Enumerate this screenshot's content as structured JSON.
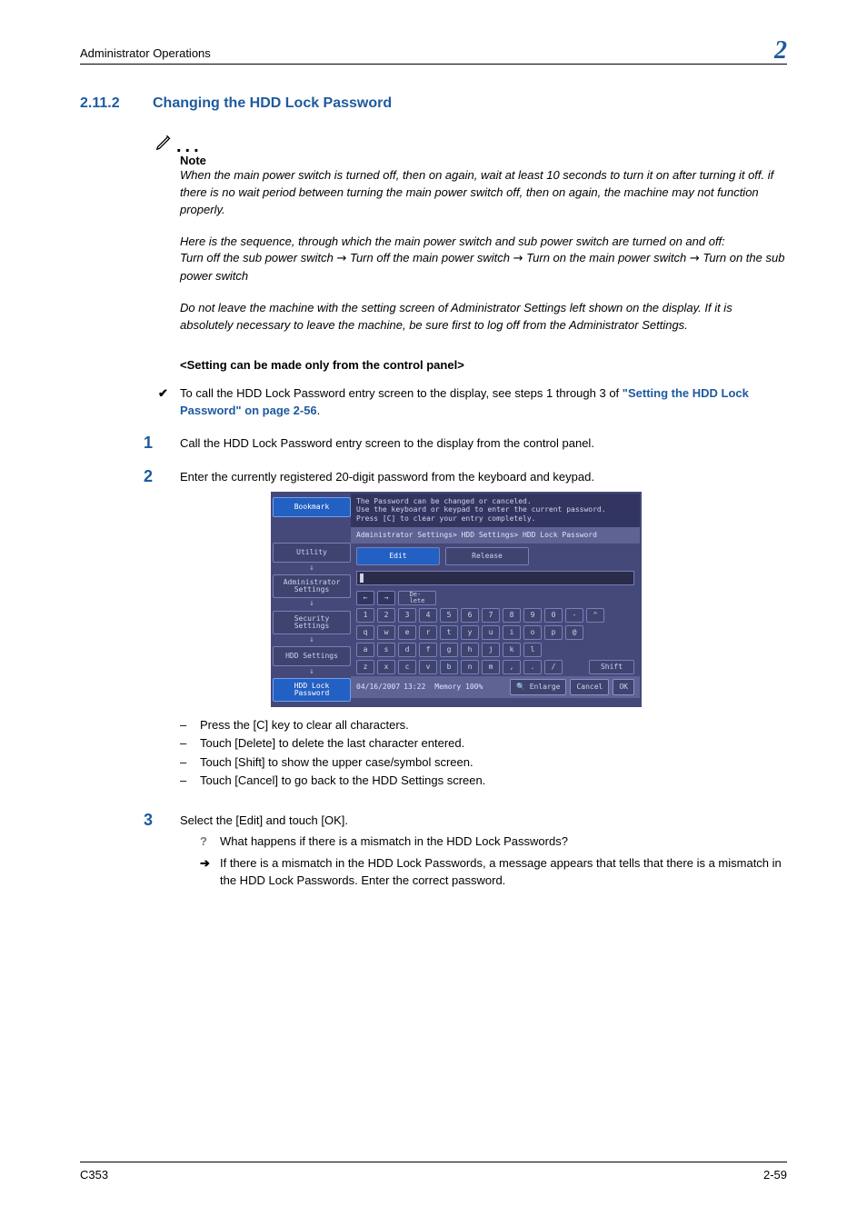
{
  "header": {
    "title": "Administrator Operations",
    "chapter": "2"
  },
  "section": {
    "number": "2.11.2",
    "title": "Changing the HDD Lock Password"
  },
  "note": {
    "label": "Note",
    "p1": "When the main power switch is turned off, then on again, wait at least 10 seconds to turn it on after turning it off. if there is no wait period between turning the main power switch off, then on again, the machine may not function properly.",
    "p2": "Here is the sequence, through which the main power switch and sub power switch are turned on and off:",
    "p3_a": "Turn off the sub power switch ",
    "p3_b": " Turn off the main power switch ",
    "p3_c": " Turn on the main power switch ",
    "p3_d": " Turn on the sub power switch",
    "p4": "Do not leave the machine with the setting screen of Administrator Settings left shown on the display. If it is absolutely necessary to leave the machine, be sure first to log off from the Administrator Settings."
  },
  "subhead": "<Setting can be made only from the control panel>",
  "check": {
    "text_a": "To call the HDD Lock Password entry screen to the display, see steps 1 through 3 of ",
    "link": "\"Setting the HDD Lock Password\" on page 2-56",
    "text_b": "."
  },
  "steps": {
    "s1": {
      "num": "1",
      "text": "Call the HDD Lock Password entry screen to the display from the control panel."
    },
    "s2": {
      "num": "2",
      "text": "Enter the currently registered 20-digit password from the keyboard and keypad.",
      "dash1": "Press the [C] key to clear all characters.",
      "dash2": "Touch [Delete] to delete the last character entered.",
      "dash3": "Touch [Shift] to show the upper case/symbol screen.",
      "dash4": "Touch [Cancel] to go back to the HDD Settings screen."
    },
    "s3": {
      "num": "3",
      "text": "Select the [Edit] and touch [OK].",
      "q": "What happens if there is a mismatch in the HDD Lock Passwords?",
      "a": "If there is a mismatch in the HDD Lock Passwords, a message appears that tells that there is a mismatch in the HDD Lock Passwords. Enter the correct password."
    }
  },
  "panel": {
    "side": {
      "bookmark": "Bookmark",
      "utility": "Utility",
      "admin": "Administrator Settings",
      "security": "Security Settings",
      "hdd": "HDD Settings",
      "lock": "HDD Lock Password"
    },
    "top1": "The Password can be changed or canceled.",
    "top2": "Use the keyboard or keypad to enter the current password.",
    "top3": "Press [C] to clear your entry completely.",
    "bc": "Administrator Settings> HDD Settings> HDD Lock Password",
    "tab_edit": "Edit",
    "tab_release": "Release",
    "del": "De-\nlete",
    "shift": "Shift",
    "row_num": [
      "1",
      "2",
      "3",
      "4",
      "5",
      "6",
      "7",
      "8",
      "9",
      "0",
      "-",
      "^"
    ],
    "row_q": [
      "q",
      "w",
      "e",
      "r",
      "t",
      "y",
      "u",
      "i",
      "o",
      "p",
      "@"
    ],
    "row_a": [
      "a",
      "s",
      "d",
      "f",
      "g",
      "h",
      "j",
      "k",
      "l"
    ],
    "row_z": [
      "z",
      "x",
      "c",
      "v",
      "b",
      "n",
      "m",
      ",",
      ".",
      "/"
    ],
    "foot_date": "04/16/2007",
    "foot_time": "13:22",
    "foot_mem": "Memory",
    "foot_memv": "100%",
    "enlarge": "Enlarge",
    "cancel": "Cancel",
    "ok": "OK"
  },
  "footer": {
    "left": "C353",
    "right": "2-59"
  }
}
